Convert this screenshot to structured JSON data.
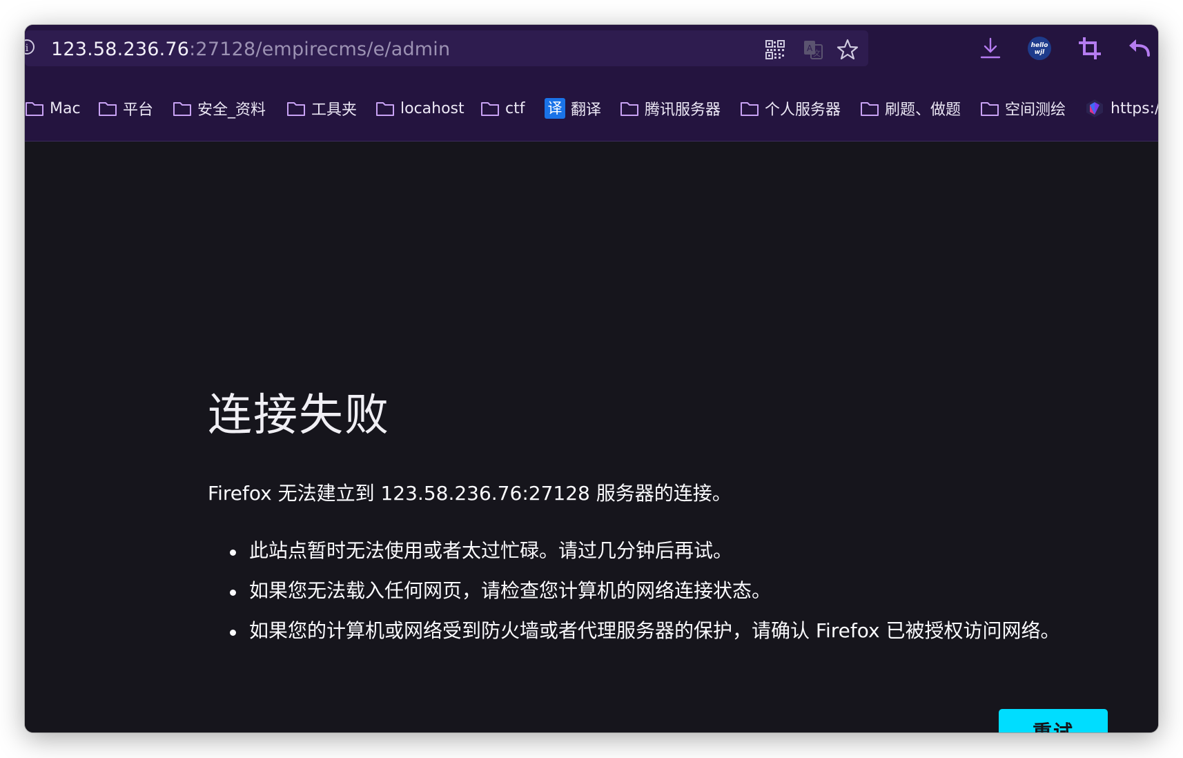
{
  "url": {
    "host": "123.58.236.76",
    "path": ":27128/empirecms/e/admin"
  },
  "icons": {
    "info": "info-icon",
    "qr": "qr-code-icon",
    "translate": "translate-icon",
    "bookmark": "star-icon",
    "download": "download-icon",
    "extension": "hello-wjl-extension-icon",
    "screenshot": "crop-icon",
    "back": "undo-arrow-icon"
  },
  "bookmarks": [
    {
      "label": "Mac",
      "type": "folder"
    },
    {
      "label": "平台",
      "type": "folder"
    },
    {
      "label": "安全_资料",
      "type": "folder"
    },
    {
      "label": "工具夹",
      "type": "folder"
    },
    {
      "label": "locahost",
      "type": "folder"
    },
    {
      "label": "ctf",
      "type": "folder"
    },
    {
      "label": "翻译",
      "type": "link",
      "badge": "译"
    },
    {
      "label": "腾讯服务器",
      "type": "folder"
    },
    {
      "label": "个人服务器",
      "type": "folder"
    },
    {
      "label": "刷题、做题",
      "type": "folder"
    },
    {
      "label": "空间测绘",
      "type": "folder"
    },
    {
      "label": "https:/",
      "type": "link"
    }
  ],
  "extension_label": "hello wjl",
  "error": {
    "title": "连接失败",
    "description": "Firefox 无法建立到 123.58.236.76:27128 服务器的连接。",
    "items": [
      "此站点暂时无法使用或者太过忙碌。请过几分钟后再试。",
      "如果您无法载入任何网页，请检查您计算机的网络连接状态。",
      "如果您的计算机或网络受到防火墙或者代理服务器的保护，请确认 Firefox 已被授权访问网络。"
    ],
    "retry_label": "重试"
  },
  "colors": {
    "toolbar": "#24143f",
    "content_bg": "#16151c",
    "retry_button": "#00ddff",
    "accent_icon": "#b57cf0"
  }
}
